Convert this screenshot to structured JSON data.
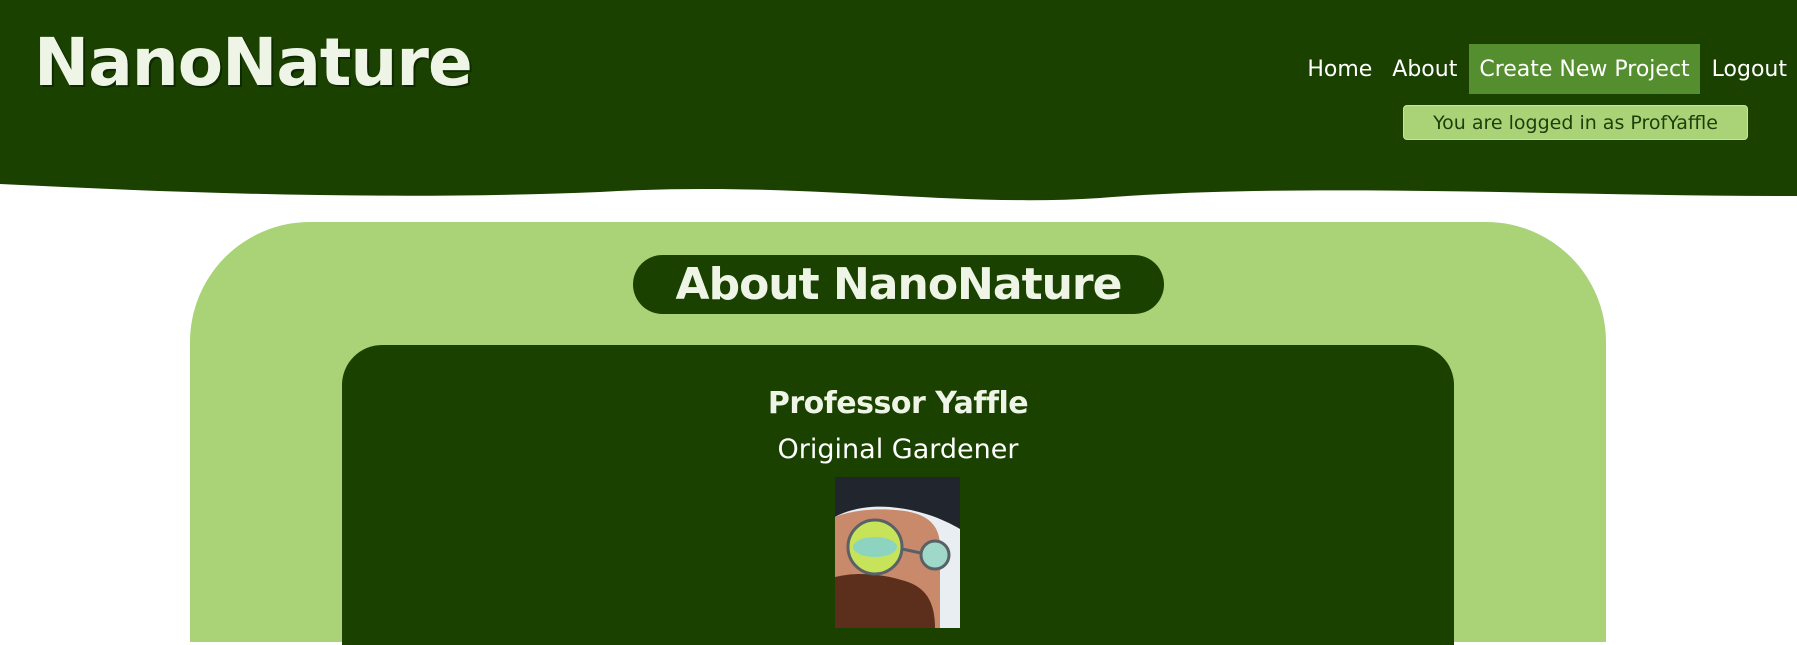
{
  "header": {
    "brand": "NanoNature",
    "bg_color": "#1a4100"
  },
  "nav": {
    "items": [
      {
        "label": "Home"
      },
      {
        "label": "About"
      },
      {
        "label": "Create New Project"
      },
      {
        "label": "Logout"
      }
    ],
    "active_color": "#548e2f"
  },
  "session": {
    "status": "You are logged in as ProfYaffle"
  },
  "about": {
    "title": "About NanoNature",
    "panel_color": "#aad378",
    "card_color": "#1a4100",
    "person": {
      "name": "Professor Yaffle",
      "role": "Original Gardener",
      "portrait_icon": "profile-photo"
    }
  }
}
